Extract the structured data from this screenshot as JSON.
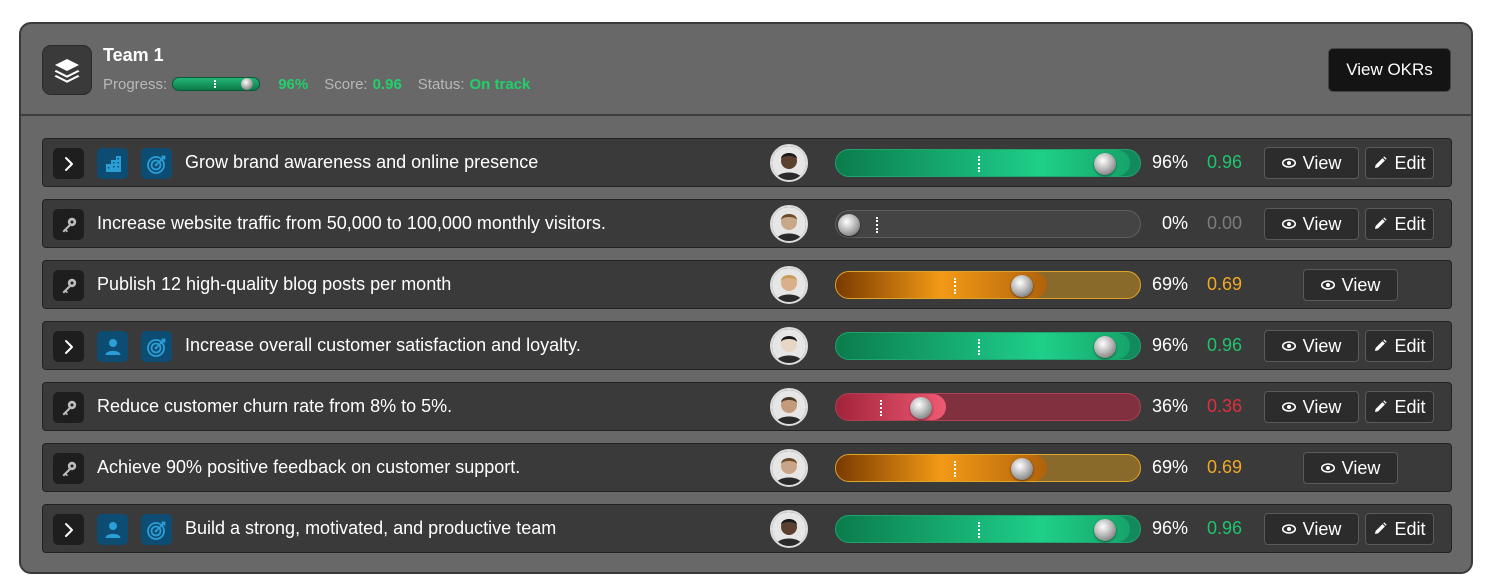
{
  "team": {
    "title": "Team 1",
    "progress_label": "Progress:",
    "progress_value": "96%",
    "progress_fraction": 0.96,
    "score_label": "Score:",
    "score_value": "0.96",
    "status_label": "Status:",
    "status_value": "On track",
    "view_okrs_label": "View OKRs"
  },
  "labels": {
    "view": "View",
    "edit": "Edit"
  },
  "colors": {
    "green": "#1fc46e",
    "grey": "#7c7c7c",
    "orange": "#f2a923",
    "red": "#e0303e",
    "brand_blue": "#0d4d73"
  },
  "rows": [
    {
      "kind": "objective",
      "icon": "building-icon",
      "title": "Grow brand awareness and online presence",
      "progress": 0.96,
      "pct": "96%",
      "score": "0.96",
      "bar": "green",
      "editable": true
    },
    {
      "kind": "key-result",
      "title": "Increase website traffic from 50,000 to 100,000 monthly visitors.",
      "progress": 0,
      "pct": "0%",
      "score": "0.00",
      "bar": "empty",
      "editable": true
    },
    {
      "kind": "key-result",
      "title": "Publish 12 high-quality blog posts per month",
      "progress": 0.69,
      "pct": "69%",
      "score": "0.69",
      "bar": "orange",
      "editable": false
    },
    {
      "kind": "objective",
      "icon": "person-icon",
      "title": "Increase overall customer satisfaction and loyalty.",
      "progress": 0.96,
      "pct": "96%",
      "score": "0.96",
      "bar": "green",
      "editable": true
    },
    {
      "kind": "key-result",
      "title": "Reduce customer churn rate from 8% to 5%.",
      "progress": 0.36,
      "pct": "36%",
      "score": "0.36",
      "bar": "red",
      "editable": true
    },
    {
      "kind": "key-result",
      "title": "Achieve 90% positive feedback on customer support.",
      "progress": 0.69,
      "pct": "69%",
      "score": "0.69",
      "bar": "orange",
      "editable": false
    },
    {
      "kind": "objective",
      "icon": "person-icon",
      "title": "Build a strong, motivated, and productive team",
      "progress": 0.96,
      "pct": "96%",
      "score": "0.96",
      "bar": "green",
      "editable": true
    }
  ]
}
